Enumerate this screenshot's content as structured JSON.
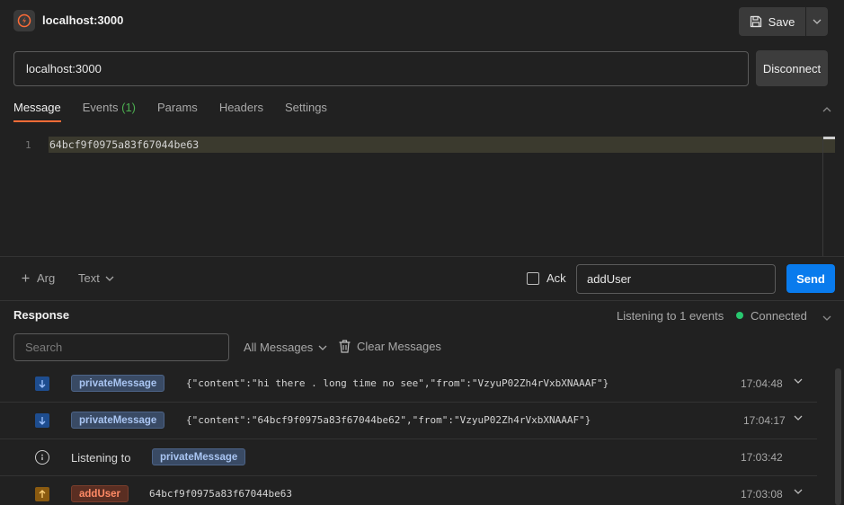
{
  "header": {
    "title": "localhost:3000",
    "save_label": "Save"
  },
  "connection": {
    "url": "localhost:3000",
    "disconnect_label": "Disconnect"
  },
  "tabs": [
    {
      "label": "Message"
    },
    {
      "label": "Events",
      "count": "(1)"
    },
    {
      "label": "Params"
    },
    {
      "label": "Headers"
    },
    {
      "label": "Settings"
    }
  ],
  "editor": {
    "line": "1",
    "code": "64bcf9f0975a83f67044be63"
  },
  "composer": {
    "arg_label": "Arg",
    "type_label": "Text",
    "ack_label": "Ack",
    "event_name": "addUser",
    "send_label": "Send"
  },
  "response": {
    "title": "Response",
    "listening": "Listening to 1 events",
    "status": "Connected",
    "search_placeholder": "Search",
    "filter_label": "All Messages",
    "clear_label": "Clear Messages"
  },
  "messages": [
    {
      "direction": "in",
      "event": "privateMessage",
      "payload": "{\"content\":\"hi there . long time no see\",\"from\":\"VzyuP02Zh4rVxbXNAAAF\"}",
      "time": "17:04:48"
    },
    {
      "direction": "in",
      "event": "privateMessage",
      "payload": "{\"content\":\"64bcf9f0975a83f67044be62\",\"from\":\"VzyuP02Zh4rVxbXNAAAF\"}",
      "time": "17:04:17"
    },
    {
      "direction": "info",
      "text": "Listening to",
      "event": "privateMessage",
      "time": "17:03:42"
    },
    {
      "direction": "out",
      "event": "addUser",
      "payload": "64bcf9f0975a83f67044be63",
      "time": "17:03:08"
    }
  ],
  "colors": {
    "accent": "#ff6c37",
    "send": "#097bed",
    "connected": "#28c76f"
  }
}
